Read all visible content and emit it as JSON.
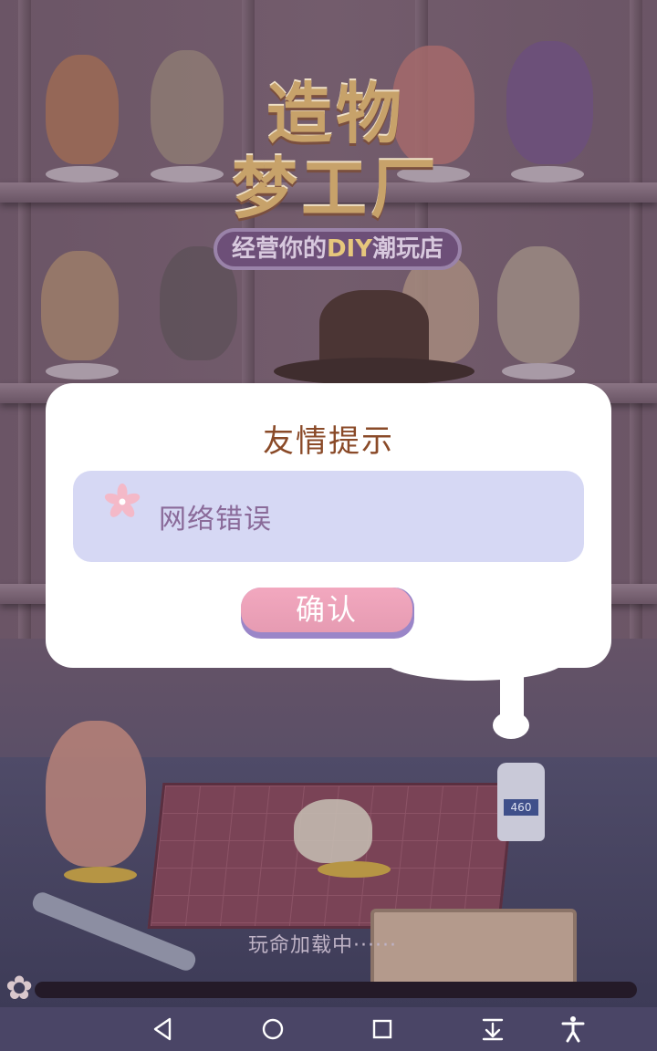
{
  "game": {
    "logo_title_line1": "造物",
    "logo_title_line2": "梦工厂",
    "logo_subtitle_prefix": "经营你的",
    "logo_subtitle_accent": "DIY",
    "logo_subtitle_suffix": "潮玩店",
    "glue_label": "460",
    "loading_text": "玩命加载中······",
    "loading_progress": 0
  },
  "dialog": {
    "title": "友情提示",
    "message": "网络错误",
    "message_icon": "pink-flower-icon",
    "confirm_label": "确认"
  },
  "navbar": {
    "items": [
      "back-icon",
      "home-icon",
      "recents-icon",
      "download-icon",
      "accessibility-icon"
    ]
  },
  "colors": {
    "dialog_title": "#8a4a28",
    "message_bg": "#d6d8f4",
    "message_text": "#8a6a99",
    "confirm_bg": "#f2a8bf",
    "confirm_shadow": "#9a86c8",
    "navbar_bg": "#4a4566"
  }
}
